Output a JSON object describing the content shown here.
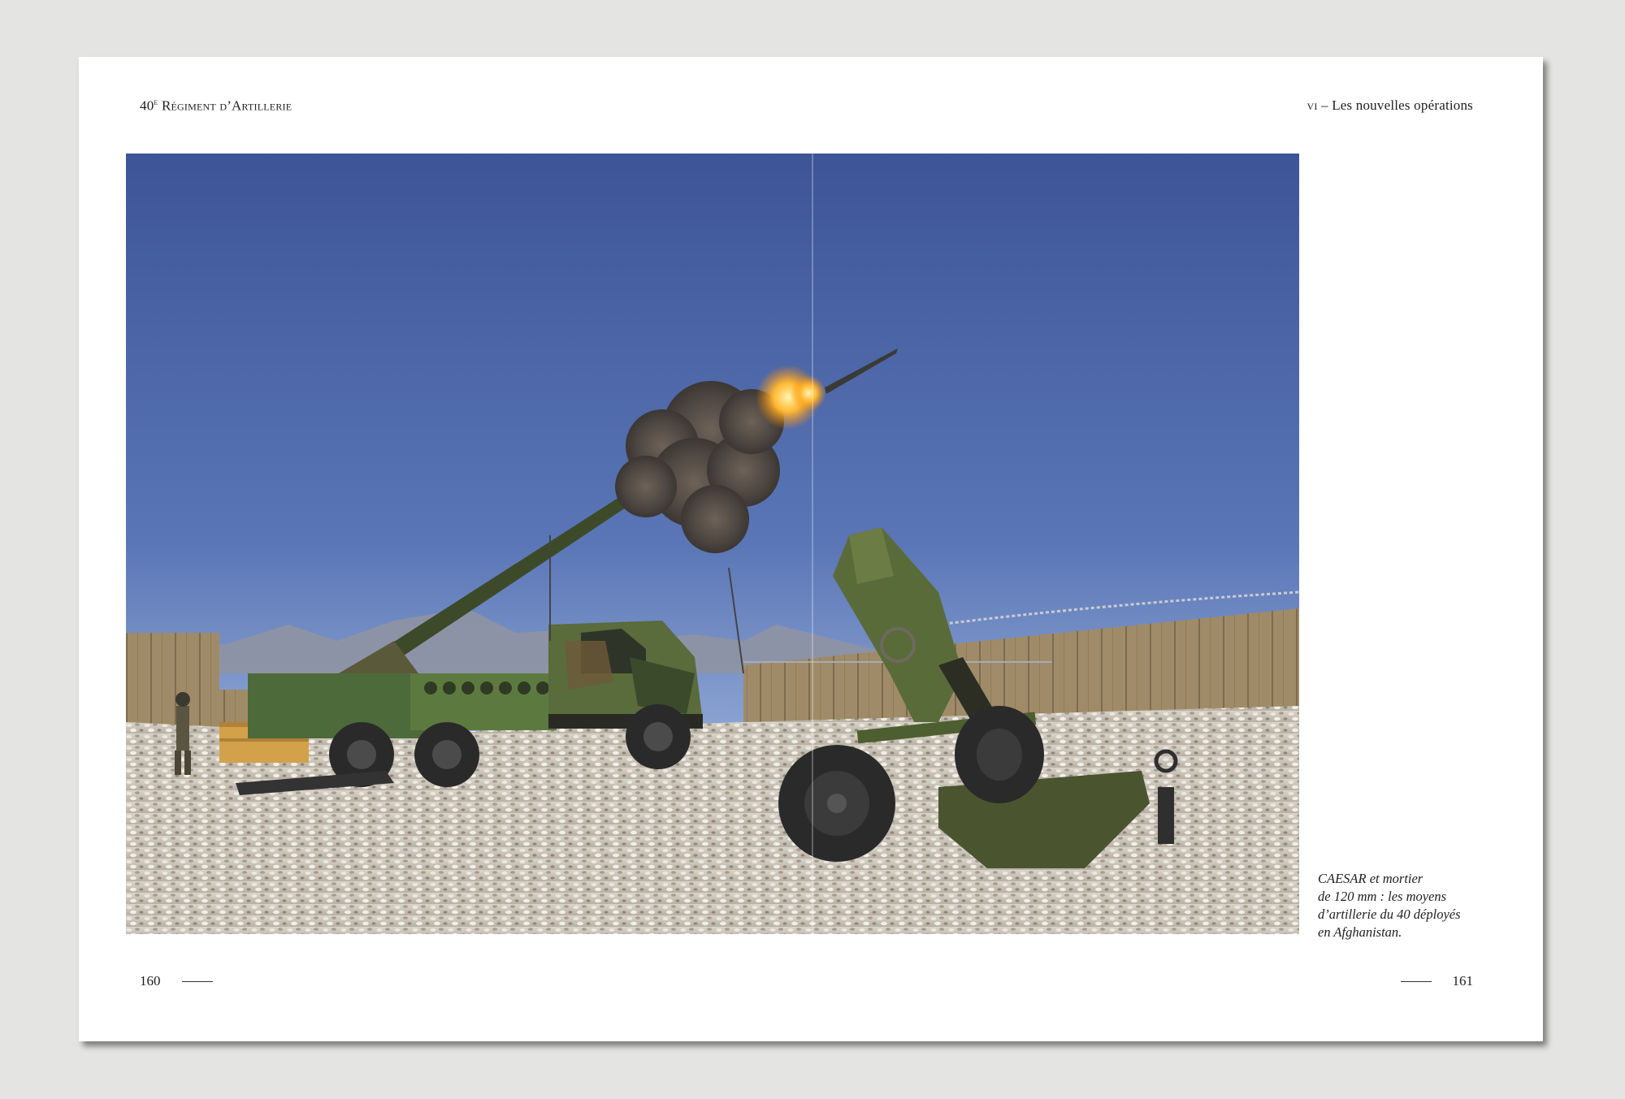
{
  "header": {
    "left_number": "40",
    "left_ordinal": "e",
    "left_title": "Régiment d’Artillerie",
    "right_chapter": "vi",
    "right_separator": "–",
    "right_title": "Les nouvelles opérations"
  },
  "photo": {
    "subject": "caesar-howitzer-firing-and-120mm-mortar"
  },
  "caption": {
    "lines": [
      "CAESAR et mortier",
      "de 120 mm : les moyens",
      "d’artillerie du 40 déployés",
      "en Afghanistan."
    ]
  },
  "footer": {
    "page_left": "160",
    "page_right": "161"
  },
  "colors": {
    "page_background": "#e4e4e2",
    "paper": "#ffffff",
    "text": "#1e1e1e",
    "sky_top": "#3d5596",
    "sky_bottom": "#9db3dc",
    "camouflage_green": "#4d6a3a"
  }
}
